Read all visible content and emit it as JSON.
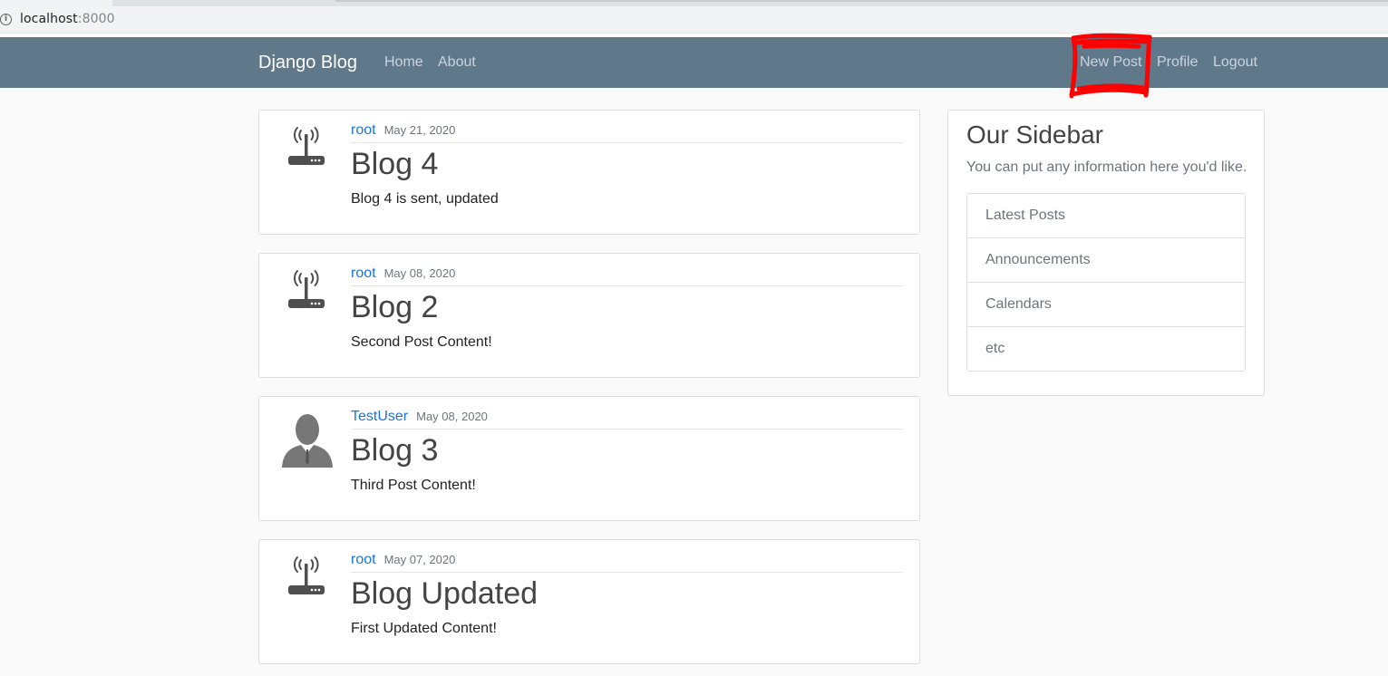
{
  "browser": {
    "url_host": "localhost",
    "url_port": ":8000",
    "info_icon": "info-circle-icon"
  },
  "navbar": {
    "brand": "Django Blog",
    "left_links": [
      "Home",
      "About"
    ],
    "right_links": [
      "New Post",
      "Profile",
      "Logout"
    ],
    "background": "#5f788a",
    "annotation_color": "#ff0000"
  },
  "posts": [
    {
      "author": "root",
      "date": "May 21, 2020",
      "title": "Blog 4",
      "content": "Blog 4 is sent, updated",
      "avatar_icon": "router-icon"
    },
    {
      "author": "root",
      "date": "May 08, 2020",
      "title": "Blog 2",
      "content": "Second Post Content!",
      "avatar_icon": "router-icon"
    },
    {
      "author": "TestUser",
      "date": "May 08, 2020",
      "title": "Blog 3",
      "content": "Third Post Content!",
      "avatar_icon": "person-silhouette-icon"
    },
    {
      "author": "root",
      "date": "May 07, 2020",
      "title": "Blog Updated",
      "content": "First Updated Content!",
      "avatar_icon": "router-icon"
    }
  ],
  "sidebar": {
    "title": "Our Sidebar",
    "description": "You can put any information here you'd like.",
    "items": [
      "Latest Posts",
      "Announcements",
      "Calendars",
      "etc"
    ]
  }
}
